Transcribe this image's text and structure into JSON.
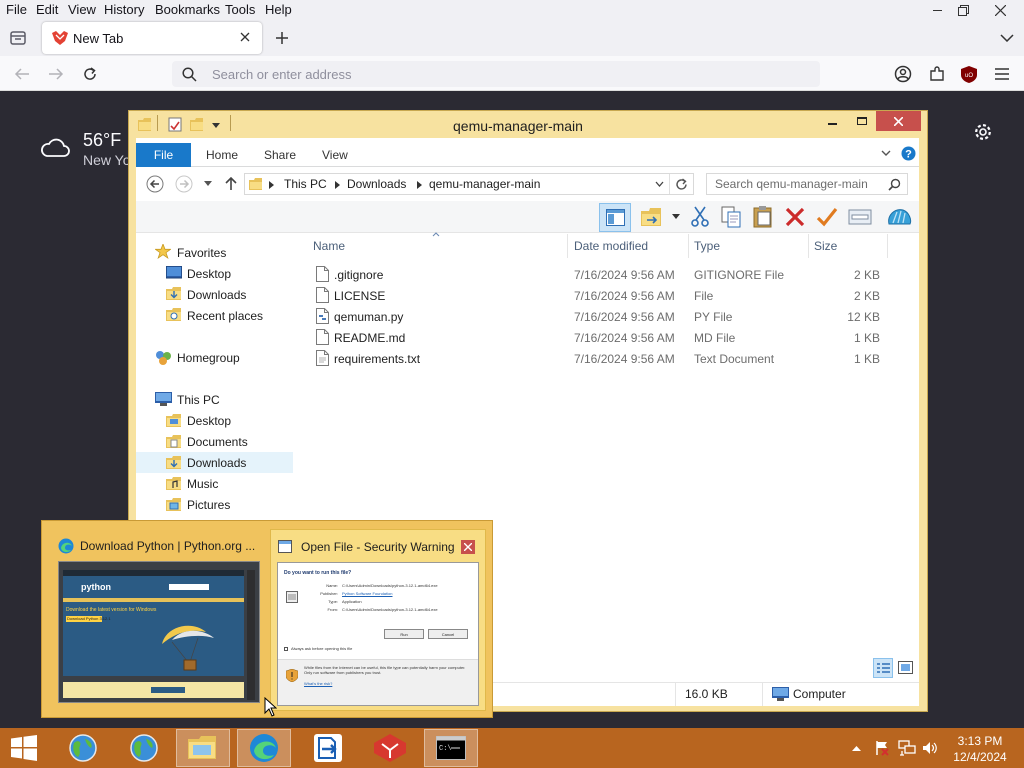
{
  "firefox": {
    "menu": [
      "File",
      "Edit",
      "View",
      "History",
      "Bookmarks",
      "Tools",
      "Help"
    ],
    "tab_label": "New Tab",
    "url_placeholder": "Search or enter address"
  },
  "newtab": {
    "temperature": "56°F",
    "location": "New Yo"
  },
  "explorer": {
    "title": "qemu-manager-main",
    "ribbon_tabs": [
      "File",
      "Home",
      "Share",
      "View"
    ],
    "breadcrumb": [
      "This PC",
      "Downloads",
      "qemu-manager-main"
    ],
    "search_placeholder": "Search qemu-manager-main",
    "columns": [
      "Name",
      "Date modified",
      "Type",
      "Size"
    ],
    "nav": {
      "favorites": "Favorites",
      "fav_items": [
        "Desktop",
        "Downloads",
        "Recent places"
      ],
      "homegroup": "Homegroup",
      "this_pc": "This PC",
      "pc_items": [
        "Desktop",
        "Documents",
        "Downloads",
        "Music",
        "Pictures"
      ]
    },
    "files": [
      {
        "name": ".gitignore",
        "date": "7/16/2024 9:56 AM",
        "type": "GITIGNORE File",
        "size": "2 KB"
      },
      {
        "name": "LICENSE",
        "date": "7/16/2024 9:56 AM",
        "type": "File",
        "size": "2 KB"
      },
      {
        "name": "qemuman.py",
        "date": "7/16/2024 9:56 AM",
        "type": "PY File",
        "size": "12 KB"
      },
      {
        "name": "README.md",
        "date": "7/16/2024 9:56 AM",
        "type": "MD File",
        "size": "1 KB"
      },
      {
        "name": "requirements.txt",
        "date": "7/16/2024 9:56 AM",
        "type": "Text Document",
        "size": "1 KB"
      }
    ],
    "status_size": "16.0 KB",
    "status_location": "Computer"
  },
  "preview": {
    "left_title": "Download Python | Python.org ...",
    "right_title": "Open File - Security Warning",
    "dialog": {
      "question": "Do you want to run this file?",
      "name_label": "Name:",
      "name_value": "C:\\Users\\Admin\\Downloads\\python-3.12.1-amd64.exe",
      "publisher_label": "Publisher:",
      "publisher_value": "Python Software Foundation",
      "type_label": "Type:",
      "type_value": "Application",
      "from_label": "From:",
      "from_value": "C:\\Users\\Admin\\Downloads\\python-3.12.1-amd64.exe",
      "run": "Run",
      "cancel": "Cancel",
      "checkbox": "Always ask before opening this file",
      "warning": "While files from the Internet can be useful, this file type can potentially harm your computer. Only run software from publishers you trust.",
      "risk_link": "What's the risk?"
    },
    "python_site": {
      "logo": "python",
      "headline": "Download the latest version for Windows",
      "button": "Download Python 3.12.1"
    }
  },
  "taskbar": {
    "time": "3:13 PM",
    "date": "12/4/2024"
  },
  "colors": {
    "taskbar": "#b8651f",
    "explorer_frame": "#f7e2a0",
    "file_tab": "#1979ca",
    "close_red": "#c7504c",
    "preview_bg": "#f0c35e"
  }
}
